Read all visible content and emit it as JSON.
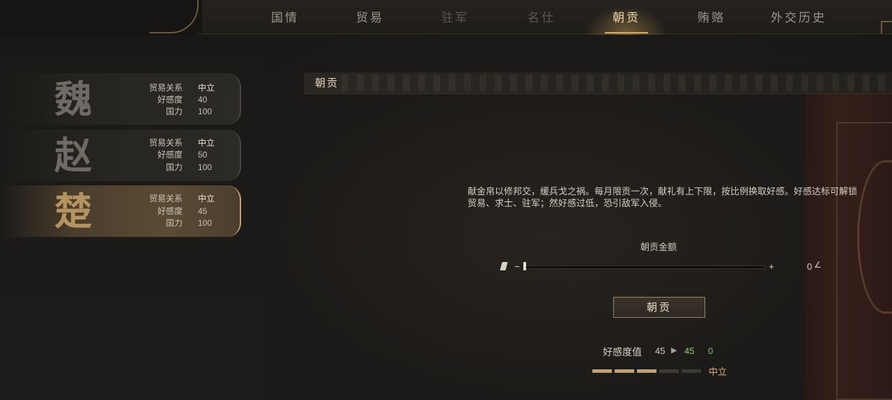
{
  "nav": {
    "tabs": [
      {
        "label": "国情",
        "state": "normal"
      },
      {
        "label": "贸易",
        "state": "normal"
      },
      {
        "label": "驻军",
        "state": "disabled"
      },
      {
        "label": "名仕",
        "state": "disabled"
      },
      {
        "label": "朝贡",
        "state": "active"
      },
      {
        "label": "贿赂",
        "state": "normal"
      },
      {
        "label": "外交历史",
        "state": "normal"
      }
    ]
  },
  "states": [
    {
      "name": "魏",
      "trade_label": "贸易关系",
      "trade_value": "中立",
      "favor_label": "好感度",
      "favor_value": "40",
      "power_label": "国力",
      "power_value": "100",
      "selected": false
    },
    {
      "name": "赵",
      "trade_label": "贸易关系",
      "trade_value": "中立",
      "favor_label": "好感度",
      "favor_value": "50",
      "power_label": "国力",
      "power_value": "100",
      "selected": false
    },
    {
      "name": "楚",
      "trade_label": "贸易关系",
      "trade_value": "中立",
      "favor_label": "好感度",
      "favor_value": "45",
      "power_label": "国力",
      "power_value": "100",
      "selected": true
    }
  ],
  "panel": {
    "title": "朝贡",
    "description": "献金帛以修邦交，缓兵戈之祸。每月限贡一次，献礼有上下限，按比例换取好感。好感达标可解锁贸易、求士、驻军；然好感过低，恐引敌军入侵。",
    "amount_label": "朝贡金额",
    "minus": "−",
    "plus": "+",
    "amount_value": "0",
    "slider_fraction": 0,
    "button_label": "朝贡",
    "favor_label": "好感度值",
    "favor_current": "45",
    "favor_new": "45",
    "favor_delta": "0",
    "favor_status": "中立",
    "favor_segments_filled": 3,
    "favor_segments_total": 5
  },
  "colors": {
    "accent": "#d4ac66",
    "positive": "#6ec74a",
    "status": "#d8b272"
  },
  "icons": {
    "coin": "coin-icon",
    "edit": "edit-icon",
    "arrow": "arrow-right-icon"
  }
}
